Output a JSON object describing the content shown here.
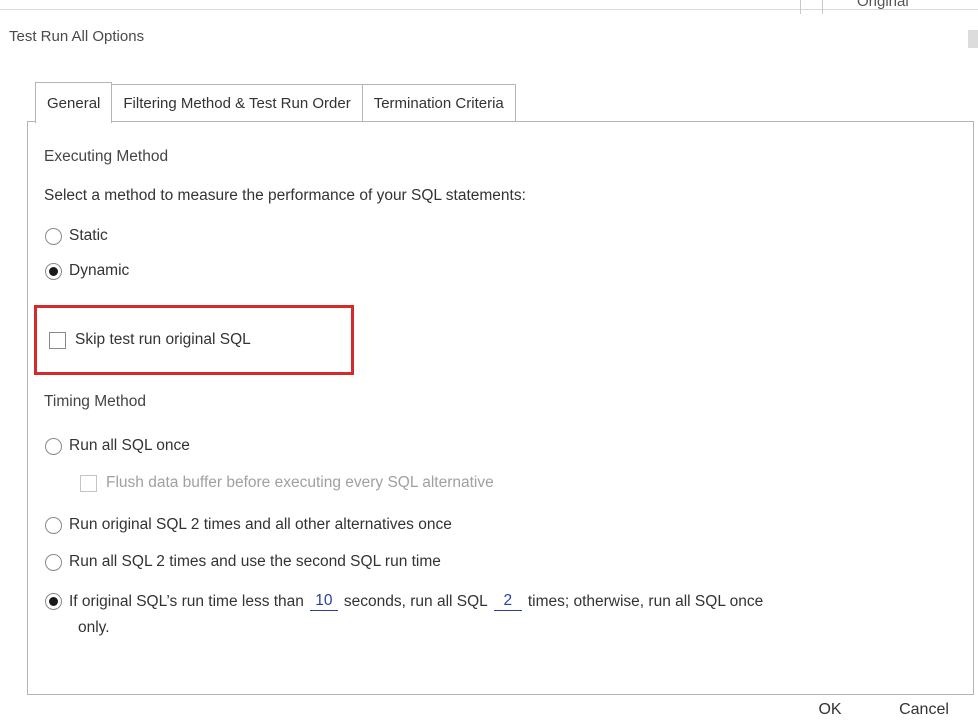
{
  "background": {
    "column_header": "Original"
  },
  "window": {
    "title": "Test Run All Options"
  },
  "tabs": [
    {
      "label": "General",
      "active": true
    },
    {
      "label": "Filtering Method & Test Run Order",
      "active": false
    },
    {
      "label": "Termination Criteria",
      "active": false
    }
  ],
  "executing": {
    "heading": "Executing Method",
    "prompt": "Select a method to measure the performance of your SQL statements:",
    "options": [
      {
        "label": "Static",
        "checked": false
      },
      {
        "label": "Dynamic",
        "checked": true
      }
    ],
    "skip_label": "Skip test run original SQL",
    "skip_checked": false
  },
  "timing": {
    "heading": "Timing Method",
    "option_once": "Run all SQL once",
    "flush_label": "Flush data buffer before executing every SQL alternative",
    "option_orig2": "Run original SQL 2 times and all other alternatives once",
    "option_all2": "Run all SQL 2 times and use the second SQL run time",
    "conditional": {
      "prefix": "If original SQL’s run time less than",
      "seconds_value": "10",
      "middle": "seconds, run all SQL",
      "times_value": "2",
      "suffix": "times; otherwise, run all SQL once",
      "wrap": "only."
    },
    "selected": "conditional"
  },
  "buttons": {
    "ok": "OK",
    "cancel": "Cancel"
  },
  "colors": {
    "highlight_border": "#d42a2a",
    "link_value": "#2b3f9e"
  }
}
